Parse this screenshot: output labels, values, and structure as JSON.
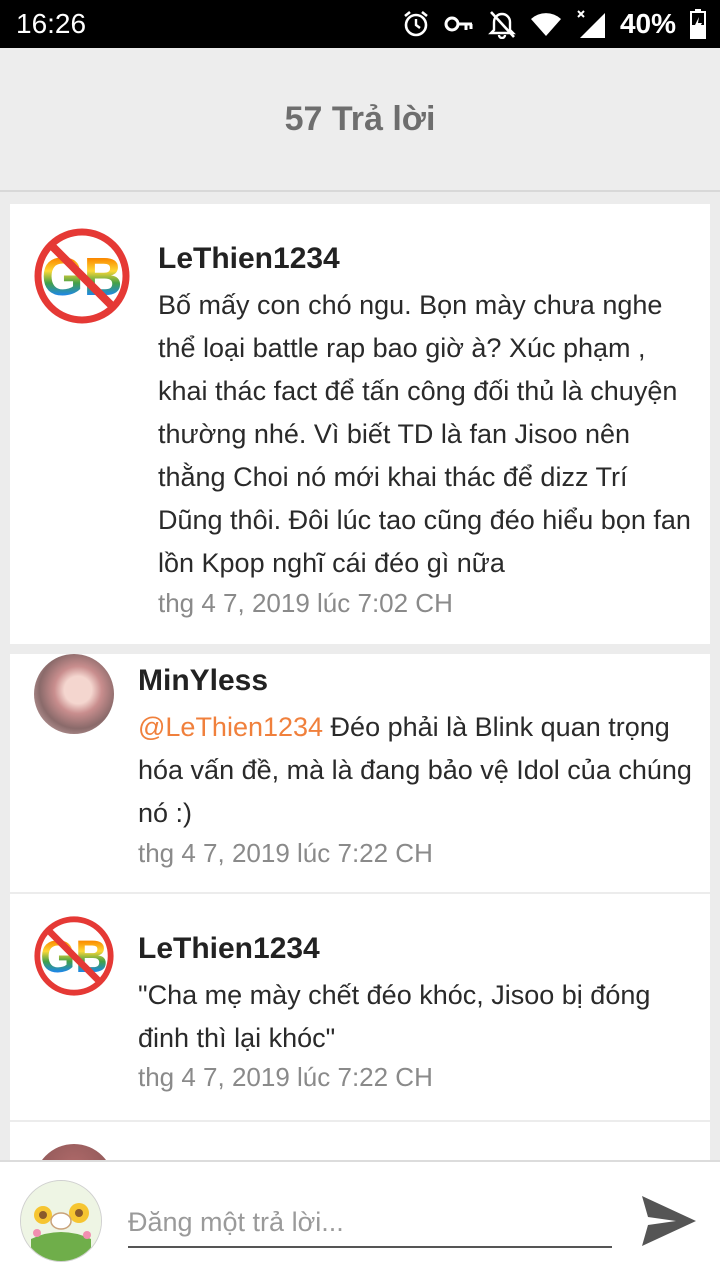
{
  "status_bar": {
    "time": "16:26",
    "battery": "40%"
  },
  "header": {
    "title": "57 Trả lời"
  },
  "comments": [
    {
      "username": "LeThien1234",
      "mention": "",
      "text": "Bố mấy con chó ngu. Bọn mày chưa nghe thể loại battle rap bao giờ à? Xúc phạm , khai thác fact để tấn công đối thủ là chuyện thường nhé. Vì biết TD là fan Jisoo nên thằng Choi nó mới khai thác để dizz Trí Dũng thôi. Đôi lúc tao cũng đéo hiểu bọn fan lồn Kpop nghĩ cái đéo gì nữa",
      "timestamp": "thg 4 7, 2019 lúc 7:02 CH",
      "avatar_text": "GB"
    },
    {
      "username": "MinYless",
      "mention": "@LeThien1234",
      "text": " Đéo phải là Blink quan trọng hóa vấn đề, mà là đang bảo vệ Idol của chúng nó :)",
      "timestamp": "thg 4 7, 2019 lúc 7:22 CH"
    },
    {
      "username": "LeThien1234",
      "mention": "",
      "text": "\"Cha mẹ mày chết đéo khóc, Jisoo bị đóng đinh thì lại khóc\"",
      "timestamp": "thg 4 7, 2019 lúc 7:22 CH",
      "avatar_text": "GB"
    }
  ],
  "reply_bar": {
    "placeholder": "Đăng một trả lời..."
  },
  "colors": {
    "mention": "#f0803c",
    "header_bg": "#ededed",
    "page_bg": "#ececec"
  },
  "icons": [
    "alarm-icon",
    "key-icon",
    "mute-icon",
    "wifi-icon",
    "signal-icon",
    "battery-icon",
    "send-icon"
  ]
}
